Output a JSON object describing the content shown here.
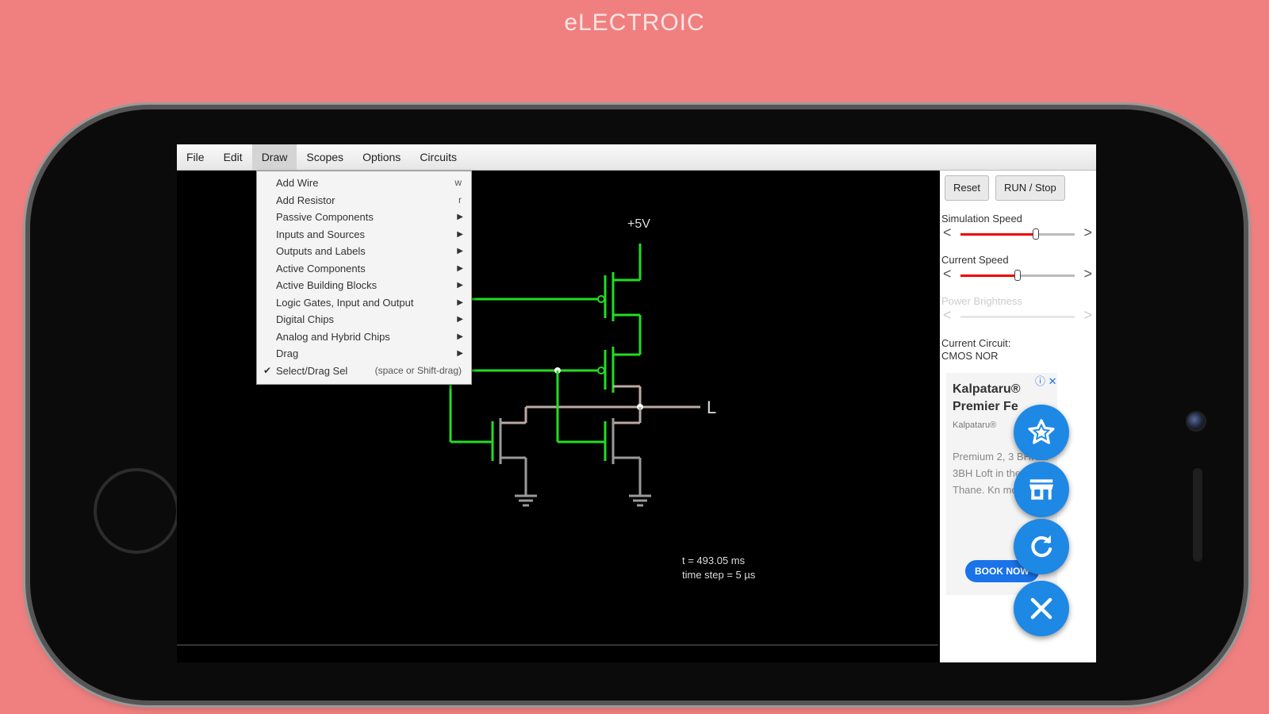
{
  "banner": {
    "title": "eLECTROIC"
  },
  "menubar": {
    "items": [
      "File",
      "Edit",
      "Draw",
      "Scopes",
      "Options",
      "Circuits"
    ]
  },
  "draw_menu": {
    "items": [
      {
        "label": "Add Wire",
        "shortcut": "w",
        "submenu": false,
        "checked": false
      },
      {
        "label": "Add Resistor",
        "shortcut": "r",
        "submenu": false,
        "checked": false
      },
      {
        "label": "Passive Components",
        "shortcut": "",
        "submenu": true,
        "checked": false
      },
      {
        "label": "Inputs and Sources",
        "shortcut": "",
        "submenu": true,
        "checked": false
      },
      {
        "label": "Outputs and Labels",
        "shortcut": "",
        "submenu": true,
        "checked": false
      },
      {
        "label": "Active Components",
        "shortcut": "",
        "submenu": true,
        "checked": false
      },
      {
        "label": "Active Building Blocks",
        "shortcut": "",
        "submenu": true,
        "checked": false
      },
      {
        "label": "Logic Gates, Input and Output",
        "shortcut": "",
        "submenu": true,
        "checked": false
      },
      {
        "label": "Digital Chips",
        "shortcut": "",
        "submenu": true,
        "checked": false
      },
      {
        "label": "Analog and Hybrid Chips",
        "shortcut": "",
        "submenu": true,
        "checked": false
      },
      {
        "label": "Drag",
        "shortcut": "",
        "submenu": true,
        "checked": false
      },
      {
        "label": "Select/Drag Sel",
        "shortcut": "(space or Shift-drag)",
        "submenu": false,
        "checked": true
      }
    ],
    "check_glyph": "✔",
    "submenu_glyph": "▶"
  },
  "circuit": {
    "supply_label": "+5V",
    "output_label": "L",
    "status_time": "t = 493.05 ms",
    "status_step": "time step = 5 µs",
    "colors": {
      "high": "#22dd22",
      "low": "#9a9a9a",
      "mid": "#bca9a3"
    }
  },
  "side_panel": {
    "reset_label": "Reset",
    "run_label": "RUN / Stop",
    "simulation_speed_label": "Simulation Speed",
    "simulation_speed_value": 0.66,
    "current_speed_label": "Current Speed",
    "current_speed_value": 0.5,
    "power_brightness_label": "Power Brightness",
    "current_circuit_label": "Current Circuit:",
    "current_circuit_name": "CMOS NOR",
    "lt_glyph": "<",
    "gt_glyph": ">"
  },
  "ad": {
    "headline": "Kalpataru® Premier Fe",
    "advertiser": "Kalpataru®",
    "body": "Premium 2, 3 BHK & 3BH Loft in the of Thane. Kn more.",
    "cta": "BOOK NOW",
    "icons": "ⓘ ✕"
  },
  "fabs": [
    {
      "name": "favorite-star-icon",
      "color": "#1e88e5"
    },
    {
      "name": "store-icon",
      "color": "#1e88e5"
    },
    {
      "name": "refresh-icon",
      "color": "#1e88e5"
    },
    {
      "name": "close-icon",
      "color": "#1e88e5"
    }
  ]
}
